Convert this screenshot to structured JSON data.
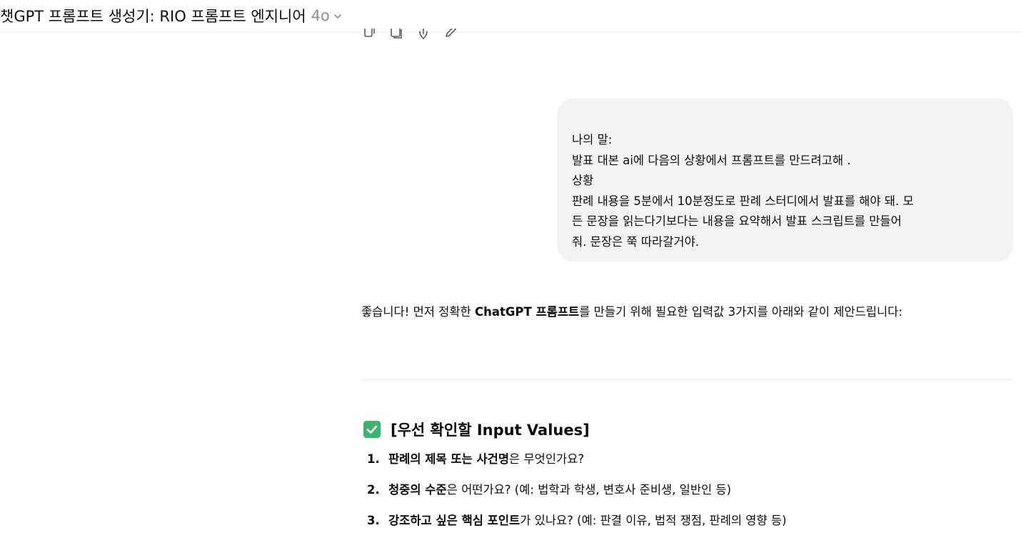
{
  "header": {
    "title": "챗GPT 프롬프트 생성기: RIO 프롬프트 엔지니어",
    "model": "4o"
  },
  "message_actions": [
    "copy-icon",
    "edit-icon",
    "share-icon",
    "pencil-icon"
  ],
  "user_message": {
    "lines": [
      "나의 말:",
      "발표 대본 ai에 다음의 상황에서 프롬프트를 만드려고해 .",
      "상황",
      "판례 내용을 5분에서 10분정도로 판례 스터디에서 발표를 해야 돼. 모",
      "든 문장을 읽는다기보다는 내용을 요약해서 발표 스크립트를 만들어",
      "줘. 문장은 쭉 따라갈거야."
    ]
  },
  "assistant": {
    "intro_before": "좋습니다! 먼저 정확한 ",
    "intro_bold": "ChatGPT 프롬프트",
    "intro_after": "를 만들기 위해 필요한 입력값 3가지를 아래와 같이 제안드립니다:",
    "section_icon": "check-mark-icon",
    "section_title": "[우선 확인할 Input Values]",
    "items": [
      {
        "number": "1.",
        "bold": "판례의 제목 또는 사건명",
        "rest": "은 무엇인가요?"
      },
      {
        "number": "2.",
        "bold": "청중의 수준",
        "rest": "은 어떤가요? (예: 법학과 학생, 변호사 준비생, 일반인 등)"
      },
      {
        "number": "3.",
        "bold": "강조하고 싶은 핵심 포인트",
        "rest": "가 있나요? (예: 판결 이유, 법적 쟁점, 판례의 영향 등)"
      }
    ]
  },
  "colors": {
    "bubble": "#f3f3f3",
    "check": "#3bb26f",
    "muted": "#8f8f8f"
  }
}
